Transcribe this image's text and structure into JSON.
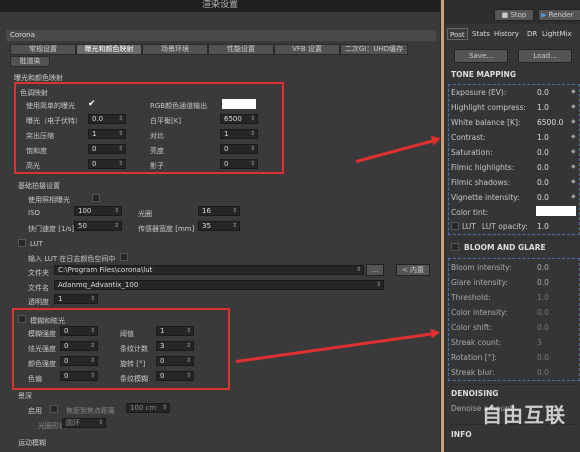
{
  "left": {
    "title": "渲染设置",
    "corona_label": "Corona",
    "tabs": [
      "常规设置",
      "曝光和颜色映射",
      "场景环境",
      "性能设置",
      "VFB 设置",
      "二次GI：UHD缓存",
      "批渲染"
    ],
    "section_exposure": "曝光和颜色映射",
    "color_mapping": {
      "header": "色调映射",
      "simple_exposure_label": "使用简单的曝光",
      "rgb_output_label": "RGB颜色通道输出",
      "exposure_label": "曝光（电子伏特）",
      "exposure_value": "0.0",
      "white_balance_label": "白平衡[K]",
      "white_balance_value": "6500",
      "highlight_label": "突出压缩",
      "highlight_value": "1",
      "contrast_label": "对比",
      "contrast_value": "1",
      "saturation_label": "饱和度",
      "saturation_value": "0",
      "brightness_label": "亮度",
      "brightness_value": "0",
      "highlights_label": "高光",
      "highlights_value": "0",
      "shadows_label": "影子",
      "shadows_value": "0"
    },
    "camera": {
      "header": "基础拍摄设置",
      "use_photo_label": "使用照相曝光",
      "iso_label": "ISO",
      "iso_value": "100",
      "fstop_label": "光圈",
      "fstop_value": "16",
      "shutter_label": "快门速度 [1/s]",
      "shutter_value": "50",
      "sensor_label": "传感器宽度 [mm]",
      "sensor_value": "35"
    },
    "lut": {
      "header": "LUT",
      "log_label": "输入 LUT 在日志颜色空间中",
      "folder_label": "文件夹",
      "folder_value": "C:\\Program Files\\corona\\lut",
      "browse_label": "...",
      "builtin_label": "< 内置",
      "file_label": "文件名",
      "file_value": "Adanmq_Advantix_100",
      "opacity_label": "透明度",
      "opacity_value": "1"
    },
    "bloom": {
      "header": "模糊和眩光",
      "bloom_intensity_label": "模糊强度",
      "bloom_intensity_value": "0",
      "threshold_label": "阈值",
      "threshold_value": "1",
      "glare_intensity_label": "炫光强度",
      "glare_intensity_value": "0",
      "streak_count_label": "条纹计数",
      "streak_count_value": "3",
      "color_intensity_label": "颜色强度",
      "color_intensity_value": "0",
      "rotation_label": "旋转 [°]",
      "rotation_value": "0",
      "color_shift_label": "色偏",
      "color_shift_value": "0",
      "streak_blur_label": "条纹模糊",
      "streak_blur_value": "0"
    },
    "dof": {
      "header": "景深",
      "enable_label": "启用",
      "distance_label": "焦距到焦点距离",
      "distance_value": "100 cm",
      "aperture_label": "光圈形状",
      "aperture_value": "圆环",
      "motion_label": "运动模糊"
    }
  },
  "right": {
    "stop_label": "Stop",
    "render_label": "Render",
    "tabs": [
      "Post",
      "Stats",
      "History",
      "DR",
      "LightMix"
    ],
    "save_label": "Save...",
    "load_label": "Load...",
    "tone_header": "TONE MAPPING",
    "tone_rows": [
      {
        "label": "Exposure (EV):",
        "value": "0.0"
      },
      {
        "label": "Highlight compress:",
        "value": "1.0"
      },
      {
        "label": "White balance [K]:",
        "value": "6500.0"
      },
      {
        "label": "Contrast:",
        "value": "1.0"
      },
      {
        "label": "Saturation:",
        "value": "0.0"
      },
      {
        "label": "Filmic highlights:",
        "value": "0.0"
      },
      {
        "label": "Filmic shadows:",
        "value": "0.0"
      },
      {
        "label": "Vignette intensity:",
        "value": "0.0"
      },
      {
        "label": "Color tint:",
        "value": ""
      },
      {
        "label": "LUT",
        "value": ""
      }
    ],
    "lut_opacity_label": "LUT opacity:",
    "lut_opacity_value": "1.0",
    "bloom_header": "BLOOM AND GLARE",
    "bloom_rows": [
      {
        "label": "Bloom intensity:",
        "value": "0.0"
      },
      {
        "label": "Glare intensity:",
        "value": "0.0"
      },
      {
        "label": "Threshold:",
        "value": "1.0"
      },
      {
        "label": "Color intensity:",
        "value": "0.0"
      },
      {
        "label": "Color shift:",
        "value": "0.0"
      },
      {
        "label": "Streak count:",
        "value": "3"
      },
      {
        "label": "Rotation [°]:",
        "value": "0.0"
      },
      {
        "label": "Streak blur:",
        "value": "0.0"
      }
    ],
    "denoise_header": "DENOISING",
    "denoise_label": "Denoise amount:",
    "info_header": "INFO"
  },
  "watermark": "自由互联",
  "colors": {
    "highlight_box": "#e03030",
    "panel_border": "#c9a17a",
    "dashed_box": "#4d6fa8"
  }
}
